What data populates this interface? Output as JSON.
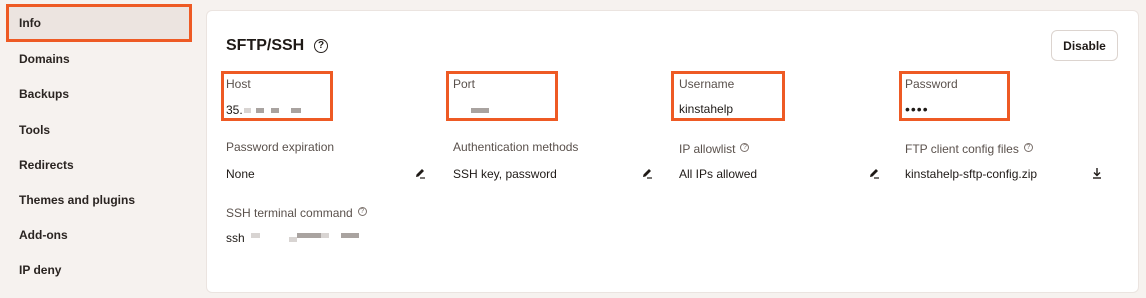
{
  "sidebar": {
    "items": [
      {
        "label": "Info",
        "active": true
      },
      {
        "label": "Domains"
      },
      {
        "label": "Backups"
      },
      {
        "label": "Tools"
      },
      {
        "label": "Redirects"
      },
      {
        "label": "Themes and plugins"
      },
      {
        "label": "Add-ons"
      },
      {
        "label": "IP deny"
      }
    ]
  },
  "card": {
    "title": "SFTP/SSH",
    "help_icon": "?",
    "disable_label": "Disable"
  },
  "fields": {
    "host": {
      "label": "Host",
      "value": "35."
    },
    "port": {
      "label": "Port",
      "value": ""
    },
    "username": {
      "label": "Username",
      "value": "kinstahelp"
    },
    "password": {
      "label": "Password",
      "value": "••••"
    },
    "password_expiration": {
      "label": "Password expiration",
      "value": "None",
      "action_icon": "pencil-icon"
    },
    "auth_methods": {
      "label": "Authentication methods",
      "value": "SSH key, password",
      "action_icon": "pencil-icon"
    },
    "ip_allowlist": {
      "label": "IP allowlist",
      "value": "All IPs allowed",
      "action_icon": "pencil-icon",
      "help": "?"
    },
    "ftp_config": {
      "label": "FTP client config files",
      "value": "kinstahelp-sftp-config.zip",
      "action_icon": "download-icon",
      "help": "?"
    },
    "ssh_command": {
      "label": "SSH terminal command",
      "value": "ssh",
      "help": "?"
    }
  },
  "colors": {
    "highlight": "#ee5a24",
    "background": "#f6f2ef",
    "card": "#ffffff"
  }
}
